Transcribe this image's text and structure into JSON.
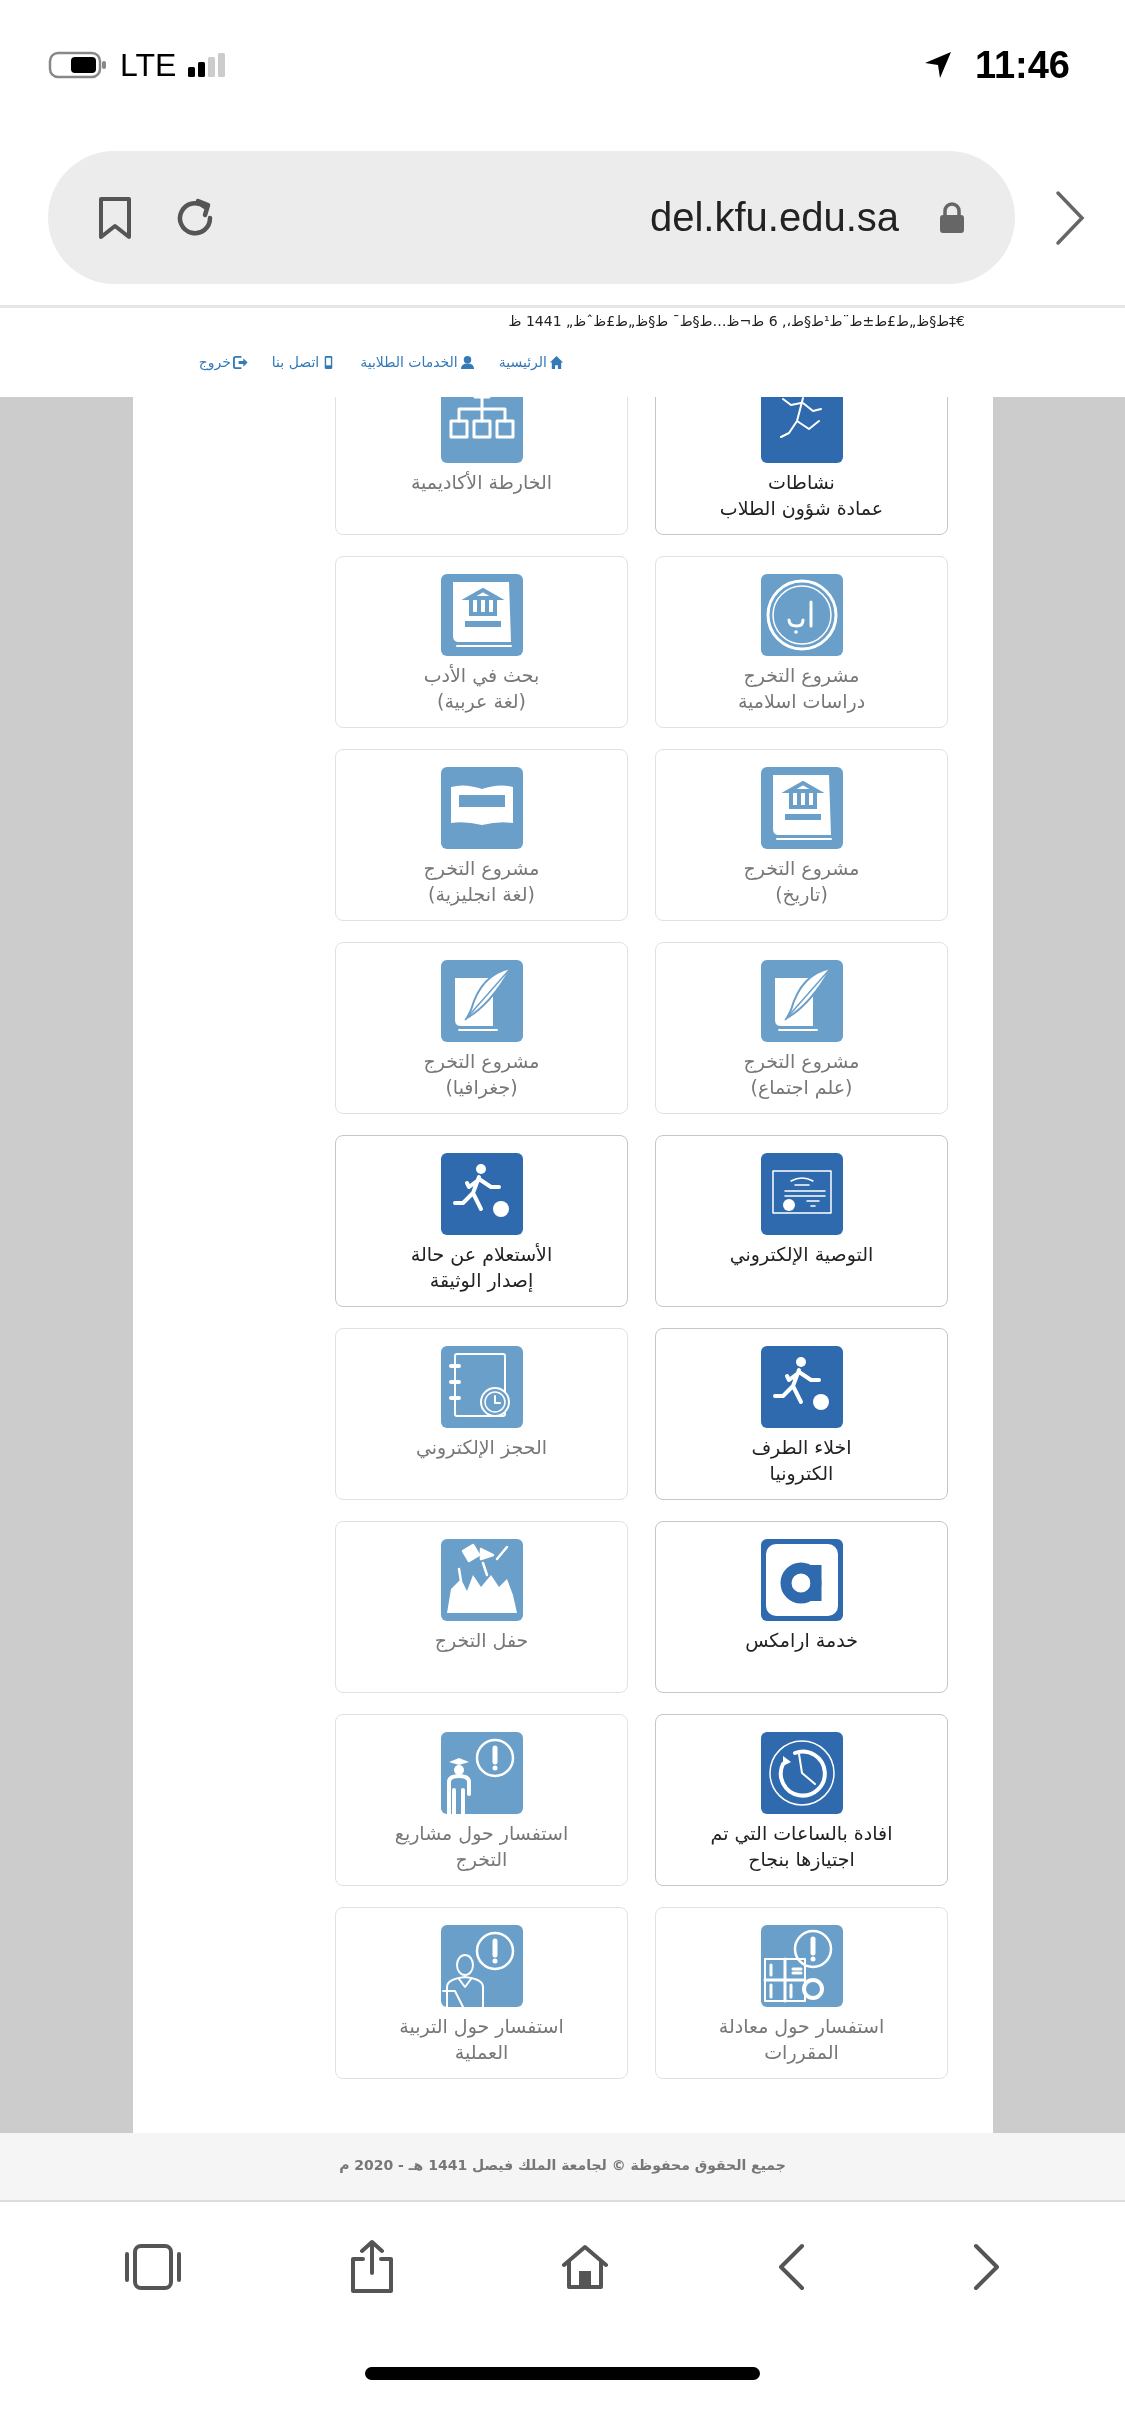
{
  "status_bar": {
    "network": "LTE",
    "time": "11:46"
  },
  "browser": {
    "url": "del.kfu.edu.sa"
  },
  "site_header": {
    "date_line": "ط§ظ„ط£ط±ط¨ط¹ط§ط،, 6 ط¬ظ…ط§ط¯ ط§ظ„ط£ظˆظ„ 1441 ظ‡€",
    "nav": [
      {
        "label": "الرئيسية"
      },
      {
        "label": "الخدمات الطلابية"
      },
      {
        "label": "اتصل بنا"
      },
      {
        "label": "خروج"
      }
    ]
  },
  "tiles": [
    {
      "lines": [
        "نشاطات",
        "عمادة شؤون الطلاب"
      ],
      "active": true
    },
    {
      "lines": [
        "الخارطة الأكاديمية"
      ],
      "active": false
    },
    {
      "lines": [
        "مشروع التخرج",
        "دراسات اسلامية"
      ],
      "active": false
    },
    {
      "lines": [
        "بحث في الأدب",
        "(لغة عربية)"
      ],
      "active": false
    },
    {
      "lines": [
        "مشروع التخرج",
        "(تاريخ)"
      ],
      "active": false
    },
    {
      "lines": [
        "مشروع التخرج",
        "(لغة انجليزية)"
      ],
      "active": false
    },
    {
      "lines": [
        "مشروع التخرج",
        "(علم اجتماع)"
      ],
      "active": false
    },
    {
      "lines": [
        "مشروع التخرج",
        "(جغرافيا)"
      ],
      "active": false
    },
    {
      "lines": [
        "التوصية الإلكتروني"
      ],
      "active": true
    },
    {
      "lines": [
        "الأستعلام عن حالة",
        "إصدار الوثيقة"
      ],
      "active": true
    },
    {
      "lines": [
        "اخلاء الطرف",
        "الكترونيا"
      ],
      "active": true
    },
    {
      "lines": [
        "الحجز الإلكتروني"
      ],
      "active": false
    },
    {
      "lines": [
        "خدمة ارامكس"
      ],
      "active": true
    },
    {
      "lines": [
        "حفل التخرج"
      ],
      "active": false
    },
    {
      "lines": [
        "افادة بالساعات التي تم",
        "اجتيازها بنجاح"
      ],
      "active": true
    },
    {
      "lines": [
        "استفسار حول مشاريع",
        "التخرج"
      ],
      "active": false
    },
    {
      "lines": [
        "استفسار حول معادلة",
        "المقررات"
      ],
      "active": false
    },
    {
      "lines": [
        "استفسار حول التربية",
        "العملية"
      ],
      "active": false
    }
  ],
  "footer": {
    "copyright": "جميع الحقوق محفوظة © لجامعة الملك فيصل 1441 هـ - 2020 م"
  }
}
